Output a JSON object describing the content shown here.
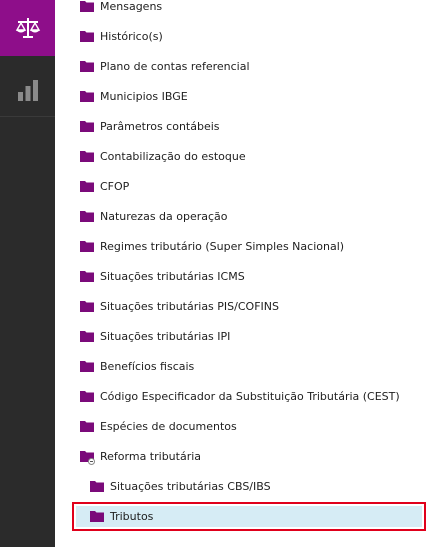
{
  "sidebar": {
    "active_icon": "balance-scale-icon",
    "second_icon": "bar-chart-icon",
    "accent_color": "#8e0e8a"
  },
  "tree": {
    "folder_color": "#7b0a7a",
    "items": [
      {
        "label": "Mensagens"
      },
      {
        "label": "Histórico(s)"
      },
      {
        "label": "Plano de contas referencial"
      },
      {
        "label": "Municipios IBGE"
      },
      {
        "label": "Parâmetros contábeis"
      },
      {
        "label": "Contabilização do estoque"
      },
      {
        "label": "CFOP"
      },
      {
        "label": "Naturezas da operação"
      },
      {
        "label": "Regimes tributário (Super Simples Nacional)"
      },
      {
        "label": "Situações tributárias ICMS"
      },
      {
        "label": "Situações tributárias PIS/COFINS"
      },
      {
        "label": "Situações tributárias IPI"
      },
      {
        "label": "Benefícios fiscais"
      },
      {
        "label": "Código Especificador da Substituição Tributária (CEST)"
      },
      {
        "label": "Espécies de documentos"
      },
      {
        "label": "Reforma tributária",
        "expanded": true
      },
      {
        "label": "Situações tributárias CBS/IBS"
      },
      {
        "label": "Tributos",
        "selected": true
      }
    ]
  }
}
